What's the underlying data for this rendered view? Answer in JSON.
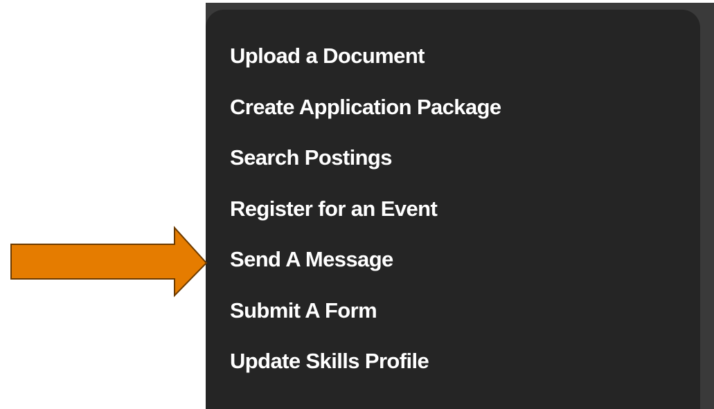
{
  "menu": {
    "items": [
      {
        "label": "Upload a Document"
      },
      {
        "label": "Create Application Package"
      },
      {
        "label": "Search Postings"
      },
      {
        "label": "Register for an Event"
      },
      {
        "label": "Send A Message"
      },
      {
        "label": "Submit A Form"
      },
      {
        "label": "Update Skills Profile"
      }
    ]
  },
  "colors": {
    "menu_background": "#252525",
    "backdrop": "#3a3a3a",
    "menu_text": "#ffffff",
    "arrow_fill": "#e57c00",
    "arrow_stroke": "#6b3a00"
  },
  "annotation": {
    "icon": "arrow-right-icon",
    "points_to": "Send A Message"
  }
}
